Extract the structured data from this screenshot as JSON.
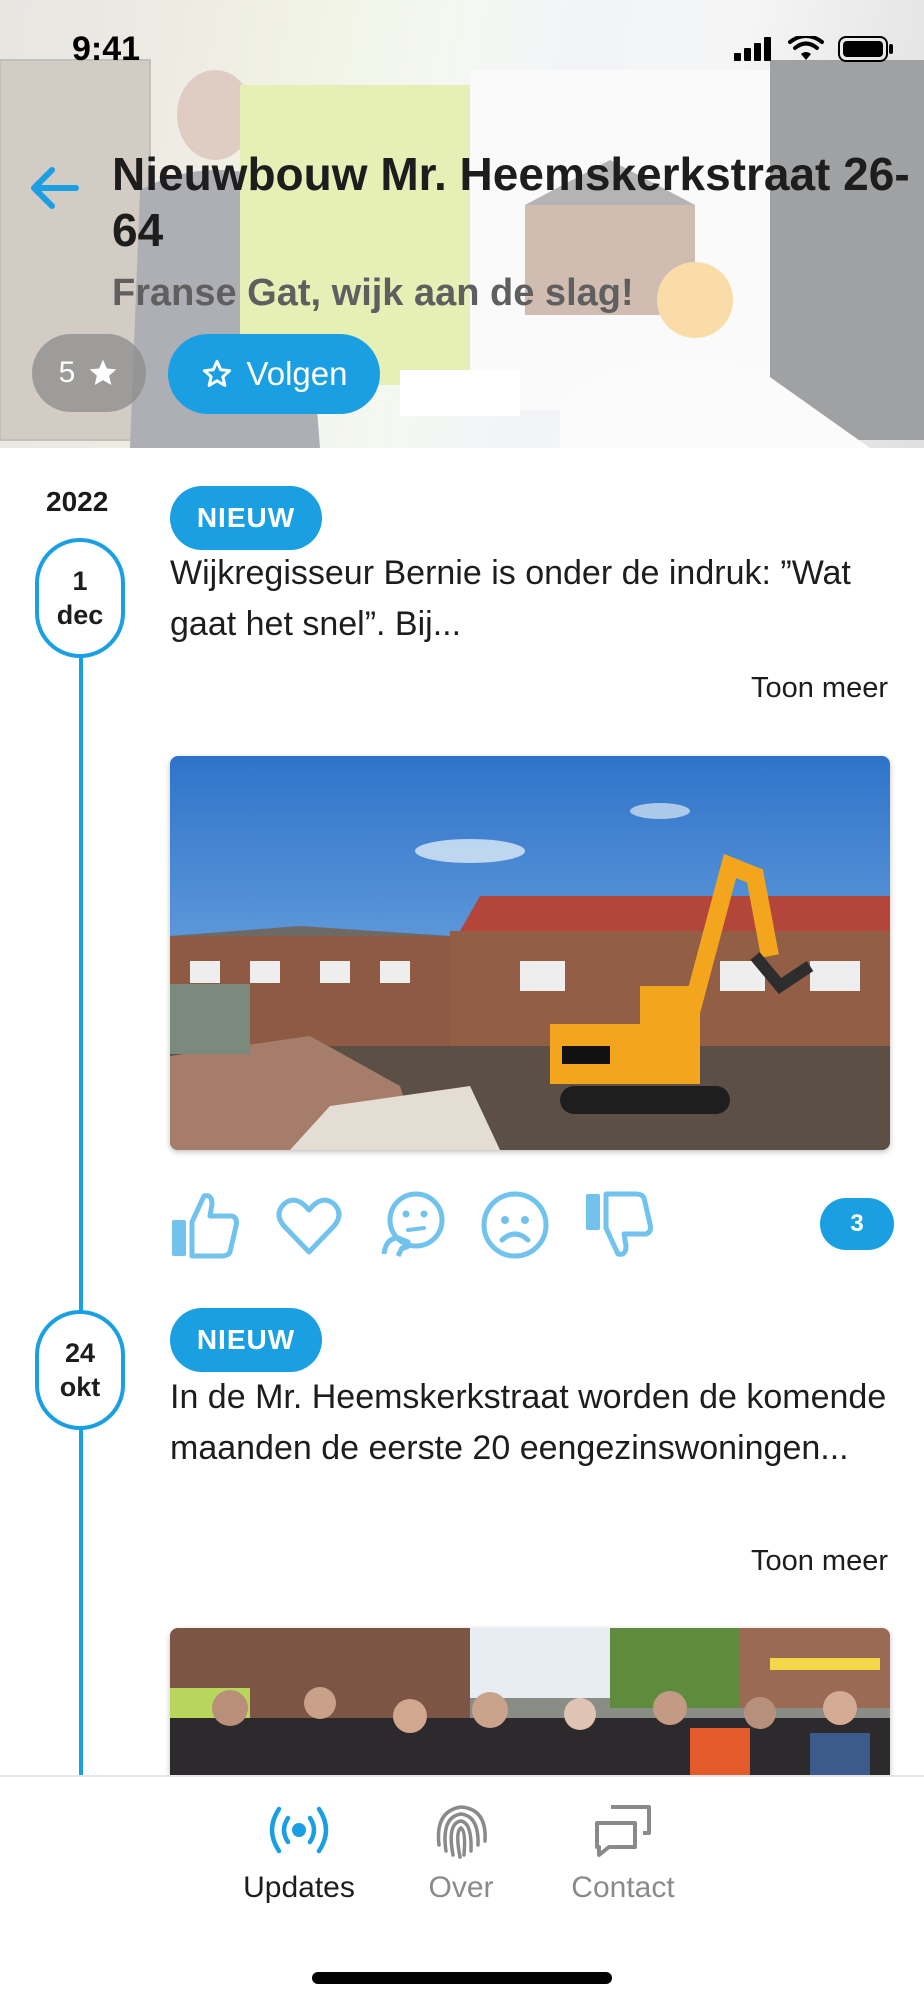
{
  "status": {
    "time": "9:41"
  },
  "header": {
    "title": "Nieuwbouw Mr. Heemskerkstraat 26-64",
    "subtitle": "Franse Gat, wijk aan de slag!",
    "rating": "5",
    "follow_label": "Volgen"
  },
  "timeline": {
    "year": "2022",
    "posts": [
      {
        "day": "1",
        "month": "dec",
        "badge": "NIEUW",
        "text": "Wijkregisseur Bernie is onder de indruk: ”Wat gaat het snel”. Bij...",
        "more": "Toon meer",
        "reaction_count": "3"
      },
      {
        "day": "24",
        "month": "okt",
        "badge": "NIEUW",
        "text": "In de Mr. Heemskerkstraat worden de komende maanden de eerste 20 eengezinswoningen...",
        "more": "Toon meer"
      }
    ]
  },
  "tabbar": {
    "tabs": [
      {
        "label": "Updates",
        "icon": "broadcast-icon",
        "active": true
      },
      {
        "label": "Over",
        "icon": "fingerprint-icon",
        "active": false
      },
      {
        "label": "Contact",
        "icon": "chat-icon",
        "active": false
      }
    ]
  },
  "colors": {
    "accent": "#1a9fe3",
    "muted": "#8a8a8a"
  }
}
